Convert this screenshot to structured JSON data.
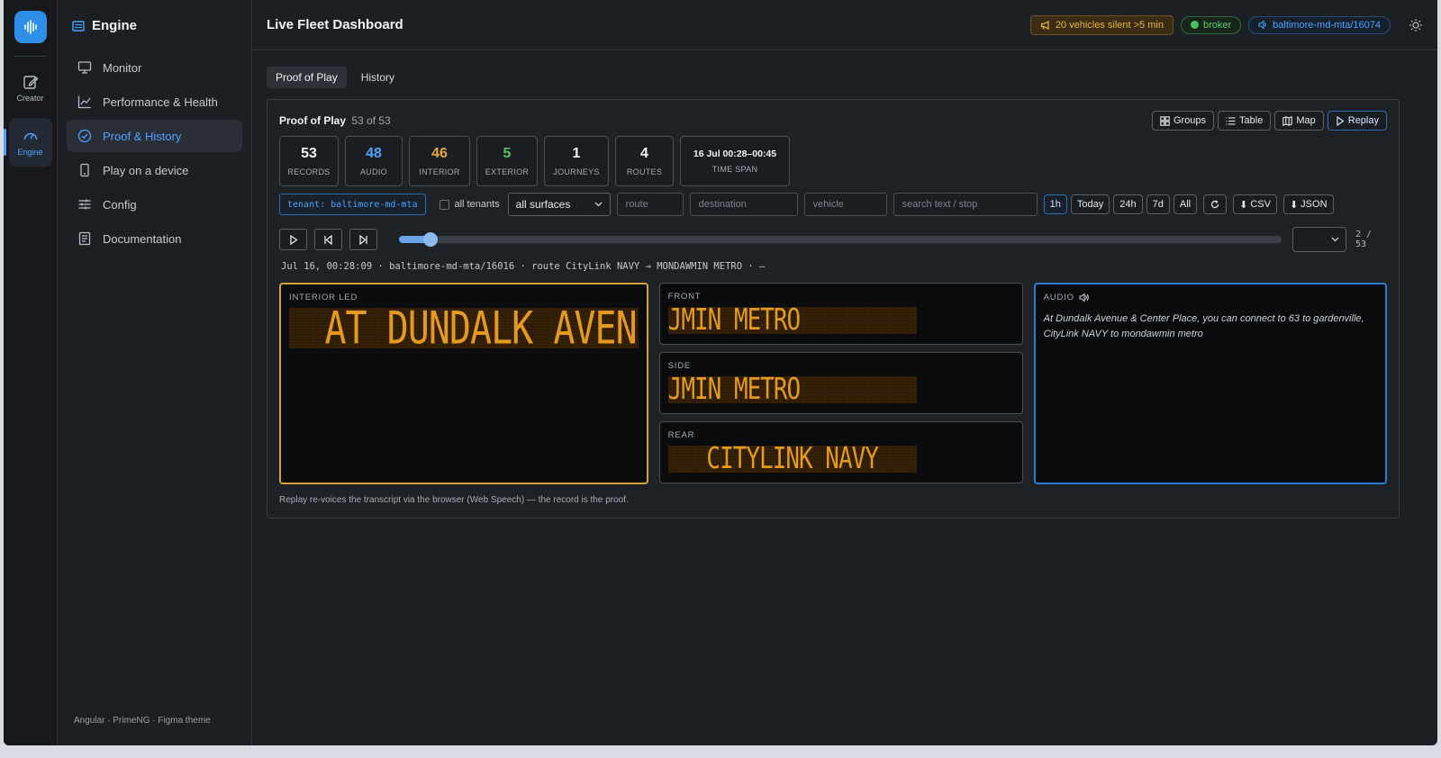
{
  "rail": {
    "items": [
      {
        "label": "Creator",
        "icon": "edit-icon"
      },
      {
        "label": "Engine",
        "icon": "gauge-icon"
      }
    ]
  },
  "sidebar": {
    "title": "Engine",
    "items": [
      {
        "label": "Monitor",
        "icon": "monitor-icon"
      },
      {
        "label": "Performance & Health",
        "icon": "chart-icon"
      },
      {
        "label": "Proof & History",
        "icon": "check-circle-icon"
      },
      {
        "label": "Play on a device",
        "icon": "device-icon"
      },
      {
        "label": "Config",
        "icon": "sliders-icon"
      },
      {
        "label": "Documentation",
        "icon": "document-icon"
      }
    ],
    "footer": "Angular · PrimeNG · Figma theme"
  },
  "header": {
    "title": "Live Fleet Dashboard",
    "alert": "20 vehicles silent >5 min",
    "broker": "broker",
    "vehicle": "baltimore-md-mta/16074"
  },
  "tabs": [
    "Proof of Play",
    "History"
  ],
  "panel": {
    "title": "Proof of Play",
    "count": "53 of 53",
    "view_buttons": [
      "Groups",
      "Table",
      "Map",
      "Replay"
    ],
    "stats": [
      {
        "value": "53",
        "label": "RECORDS",
        "color": "#f1f3f5"
      },
      {
        "value": "48",
        "label": "AUDIO",
        "color": "#4aa3ff"
      },
      {
        "value": "46",
        "label": "INTERIOR",
        "color": "#e8a93a"
      },
      {
        "value": "5",
        "label": "EXTERIOR",
        "color": "#54c46a"
      },
      {
        "value": "1",
        "label": "JOURNEYS",
        "color": "#f1f3f5"
      },
      {
        "value": "4",
        "label": "ROUTES",
        "color": "#f1f3f5"
      },
      {
        "value": "16 Jul 00:28–00:45",
        "label": "TIME SPAN",
        "color": "#f1f3f5"
      }
    ],
    "filters": {
      "tenant": "tenant: baltimore-md-mta",
      "all_tenants": "all tenants",
      "surface": "all surfaces",
      "route_placeholder": "route",
      "destination_placeholder": "destination",
      "vehicle_placeholder": "vehicle",
      "search_placeholder": "search text / stop",
      "time_ranges": [
        "1h",
        "Today",
        "24h",
        "7d",
        "All"
      ],
      "selected_range": "1h",
      "csv": "CSV",
      "json": "JSON"
    },
    "player": {
      "progress": 0.035,
      "counter": "2 / 53"
    },
    "meta": "Jul 16, 00:28:09 · baltimore-md-mta/16016 · route CityLink NAVY → MONDAWMIN METRO · —",
    "interior": {
      "label": "INTERIOR LED",
      "text": "AT DUNDALK AVEN"
    },
    "front": {
      "label": "FRONT",
      "text": "JMIN METRO"
    },
    "side": {
      "label": "SIDE",
      "text": "JMIN METRO"
    },
    "rear": {
      "label": "REAR",
      "text": "CITYLINK NAVY"
    },
    "audio": {
      "label": "AUDIO",
      "text": "At Dundalk Avenue & Center Place, you can connect to 63 to gardenville, CityLink NAVY to mondawmin metro"
    },
    "footnote": "Replay re-voices the transcript via the browser (Web Speech) — the record is the proof."
  }
}
